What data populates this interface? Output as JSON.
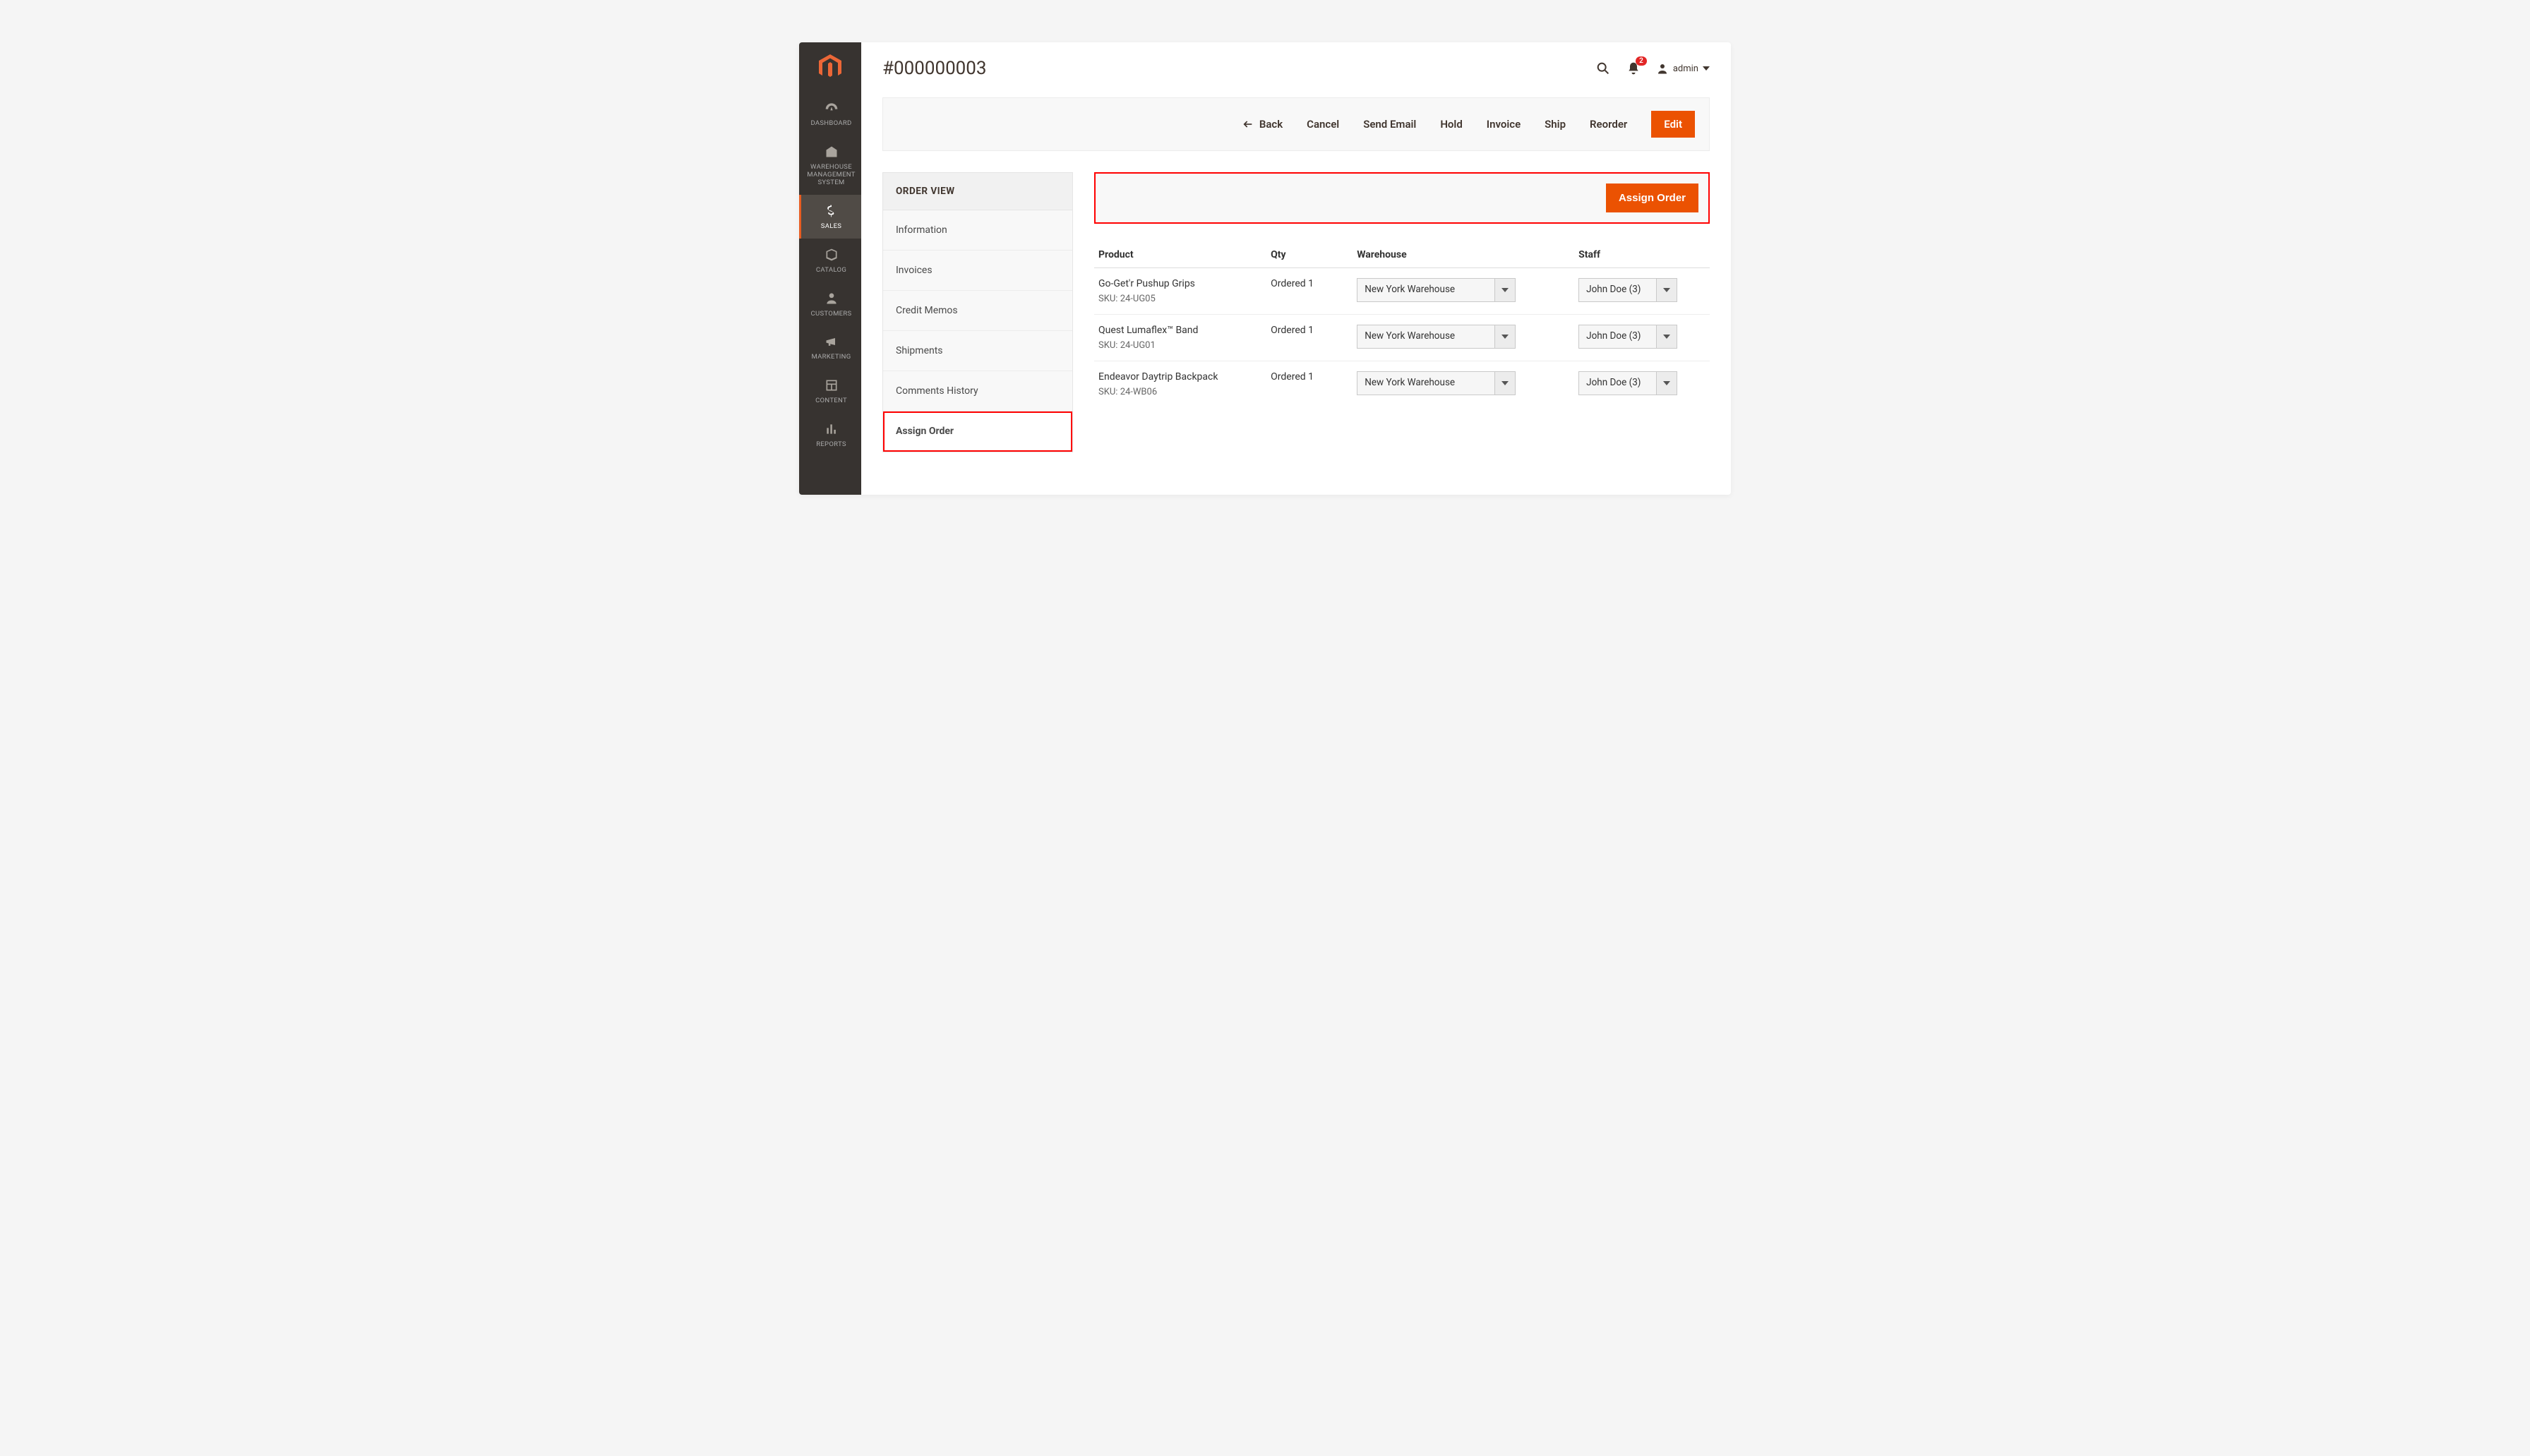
{
  "sidebar": {
    "items": [
      {
        "label": "DASHBOARD"
      },
      {
        "label": "WAREHOUSE MANAGEMENT SYSTEM"
      },
      {
        "label": "SALES"
      },
      {
        "label": "CATALOG"
      },
      {
        "label": "CUSTOMERS"
      },
      {
        "label": "MARKETING"
      },
      {
        "label": "CONTENT"
      },
      {
        "label": "REPORTS"
      }
    ],
    "active_index": 2
  },
  "header": {
    "title": "#000000003",
    "notification_count": "2",
    "username": "admin"
  },
  "toolbar": {
    "back": "Back",
    "cancel": "Cancel",
    "send_email": "Send Email",
    "hold": "Hold",
    "invoice": "Invoice",
    "ship": "Ship",
    "reorder": "Reorder",
    "edit": "Edit"
  },
  "orderview": {
    "title": "ORDER VIEW",
    "items": [
      "Information",
      "Invoices",
      "Credit Memos",
      "Shipments",
      "Comments History",
      "Assign Order"
    ],
    "active_index": 5
  },
  "assign": {
    "button_label": "Assign Order"
  },
  "table": {
    "headers": {
      "product": "Product",
      "qty": "Qty",
      "warehouse": "Warehouse",
      "staff": "Staff"
    },
    "sku_prefix": "SKU: ",
    "rows": [
      {
        "product": "Go-Get'r Pushup Grips",
        "sku": "24-UG05",
        "qty": "Ordered 1",
        "warehouse": "New York Warehouse",
        "staff": "John Doe (3)"
      },
      {
        "product": "Quest Lumaflex™ Band",
        "sku": "24-UG01",
        "qty": "Ordered 1",
        "warehouse": "New York Warehouse",
        "staff": "John Doe (3)"
      },
      {
        "product": "Endeavor Daytrip Backpack",
        "sku": "24-WB06",
        "qty": "Ordered 1",
        "warehouse": "New York Warehouse",
        "staff": "John Doe (3)"
      }
    ]
  }
}
